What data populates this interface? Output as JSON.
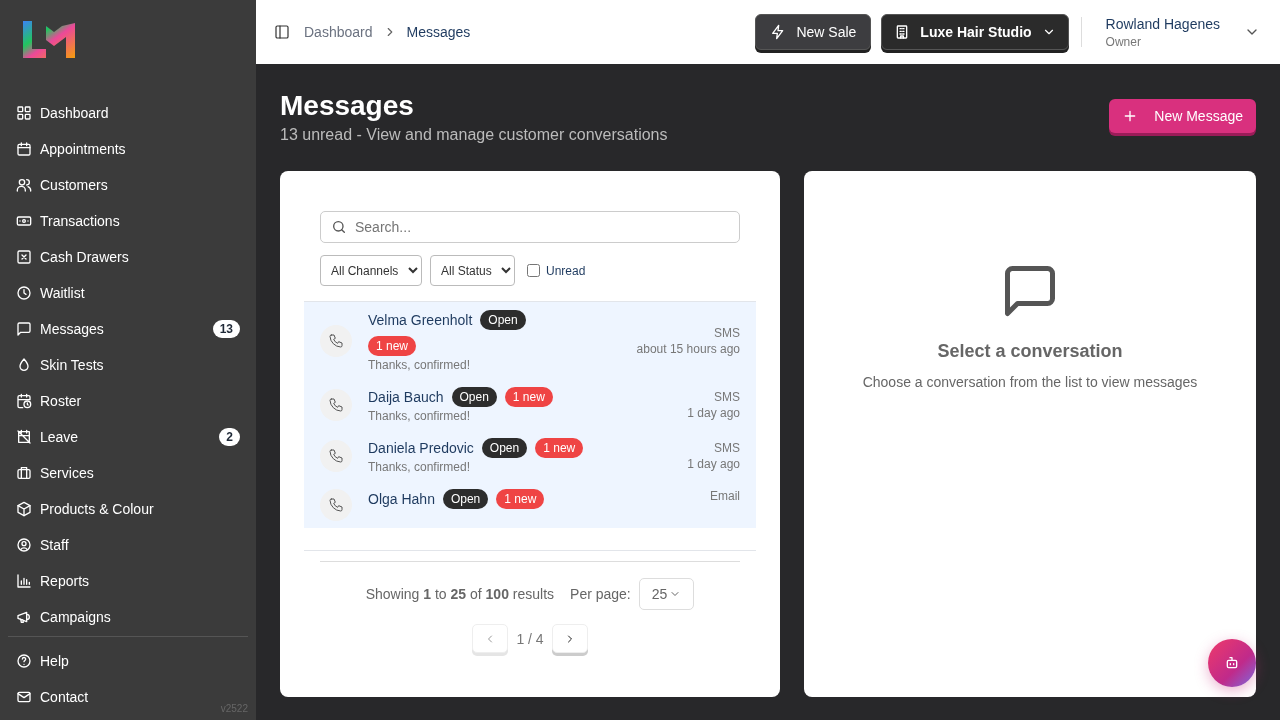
{
  "sidebar": {
    "items": [
      {
        "label": "Dashboard"
      },
      {
        "label": "Appointments"
      },
      {
        "label": "Customers"
      },
      {
        "label": "Transactions"
      },
      {
        "label": "Cash Drawers"
      },
      {
        "label": "Waitlist"
      },
      {
        "label": "Messages",
        "badge": "13"
      },
      {
        "label": "Skin Tests"
      },
      {
        "label": "Roster"
      },
      {
        "label": "Leave",
        "badge": "2"
      },
      {
        "label": "Services"
      },
      {
        "label": "Products & Colour"
      },
      {
        "label": "Staff"
      },
      {
        "label": "Reports"
      },
      {
        "label": "Campaigns"
      }
    ],
    "footer_items": [
      {
        "label": "Help"
      },
      {
        "label": "Contact"
      }
    ],
    "version": "v2522"
  },
  "header": {
    "breadcrumbs": [
      {
        "label": "Dashboard",
        "selected": false
      },
      {
        "label": "Messages",
        "selected": true
      }
    ],
    "new_sale": "New Sale",
    "location": "Luxe Hair Studio",
    "user": {
      "name": "Rowland Hagenes",
      "role": "Owner"
    }
  },
  "page": {
    "title": "Messages",
    "subtitle": "13 unread - View and manage customer conversations",
    "new_message": "New Message"
  },
  "list": {
    "search": {
      "placeholder": "Search..."
    },
    "filters": [
      {
        "value": "All Channels"
      },
      {
        "value": "All Status"
      }
    ],
    "unread_filter": {
      "label": "Unread",
      "checked": false
    },
    "conversations": [
      {
        "name": "Velma Greenholt",
        "status": "Open",
        "new": "1 new",
        "preview": "Thanks, confirmed!",
        "channel": "SMS",
        "time": "about 15 hours ago",
        "unread": true
      },
      {
        "name": "Daija Bauch",
        "status": "Open",
        "new": "1 new",
        "preview": "Thanks, confirmed!",
        "channel": "SMS",
        "time": "1 day ago",
        "unread": true
      },
      {
        "name": "Daniela Predovic",
        "status": "Open",
        "new": "1 new",
        "preview": "Thanks, confirmed!",
        "channel": "SMS",
        "time": "1 day ago",
        "unread": true
      },
      {
        "name": "Olga Hahn",
        "status": "Open",
        "new": "1 new",
        "channel": "Email",
        "unread": true
      }
    ],
    "summary": "Showing **1** to **25** of **100** results",
    "per_page_label": "Per page:",
    "per_page": "25",
    "page_indicator": "1 / 4"
  },
  "detail": {
    "title": "Select a conversation",
    "hint": "Choose a conversation from the list to view messages"
  }
}
